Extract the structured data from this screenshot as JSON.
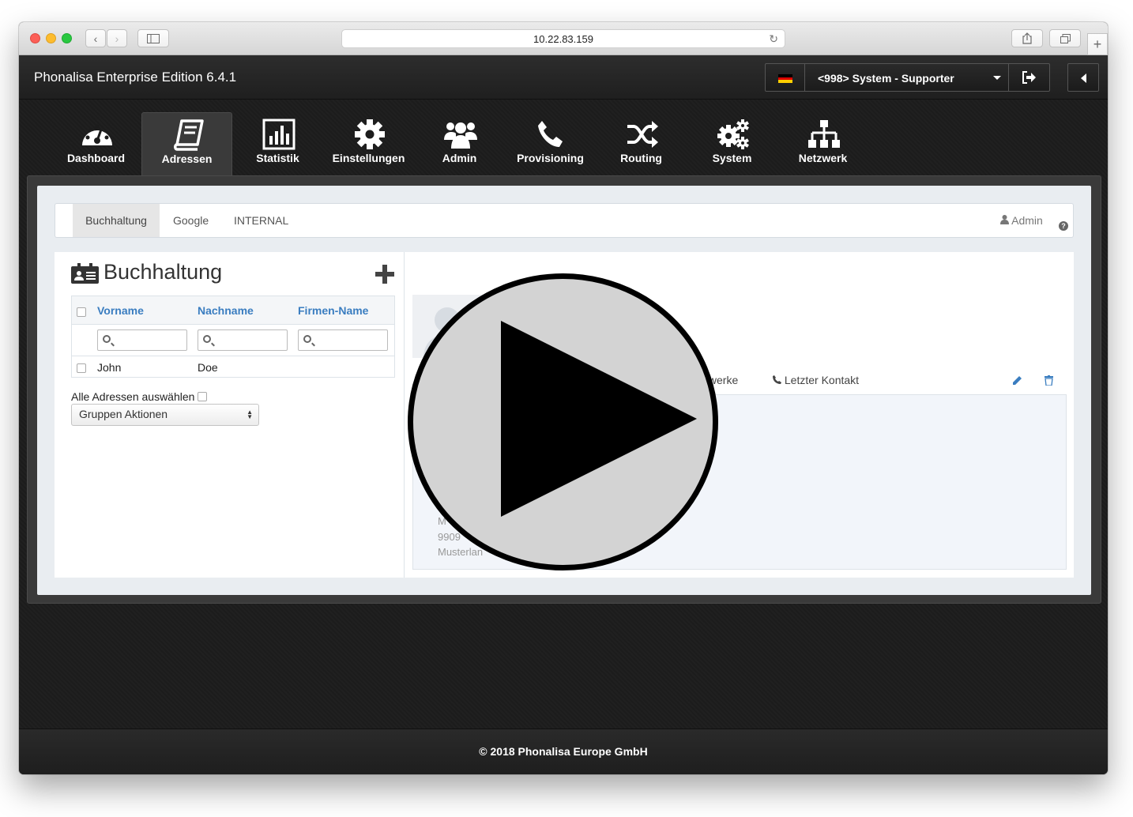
{
  "browser": {
    "url": "10.22.83.159"
  },
  "app": {
    "title": "Phonalisa Enterprise Edition 6.4.1",
    "user_label": "<998> System - Supporter",
    "footer": "© 2018 Phonalisa Europe GmbH"
  },
  "nav": {
    "items": [
      {
        "label": "Dashboard",
        "icon": "dashboard-gauge-icon"
      },
      {
        "label": "Adressen",
        "icon": "address-book-icon",
        "active": true
      },
      {
        "label": "Statistik",
        "icon": "bar-chart-icon"
      },
      {
        "label": "Einstellungen",
        "icon": "gear-icon"
      },
      {
        "label": "Admin",
        "icon": "users-icon"
      },
      {
        "label": "Provisioning",
        "icon": "phone-icon"
      },
      {
        "label": "Routing",
        "icon": "shuffle-icon"
      },
      {
        "label": "System",
        "icon": "gears-icon"
      },
      {
        "label": "Netzwerk",
        "icon": "sitemap-icon"
      }
    ]
  },
  "tabs": {
    "items": [
      "Buchhaltung",
      "Google",
      "INTERNAL"
    ],
    "active": "Buchhaltung",
    "admin_link": "Admin"
  },
  "list": {
    "title": "Buchhaltung",
    "columns": [
      "Vorname",
      "Nachname",
      "Firmen-Name"
    ],
    "rows": [
      {
        "vorname": "John",
        "nachname": "Doe",
        "firma": ""
      }
    ],
    "select_all_label": "Alle Adressen auswählen",
    "group_actions": "Gruppen Aktionen"
  },
  "detail": {
    "tab_partial": "tzwerke",
    "last_contact": "Letzter Kontakt",
    "address_lines": [
      "M",
      "9909",
      "Musterlan"
    ]
  },
  "colors": {
    "link_blue": "#3a7dc0",
    "header_dark": "#1f1f1f",
    "panel_bg": "#e9edf1"
  }
}
